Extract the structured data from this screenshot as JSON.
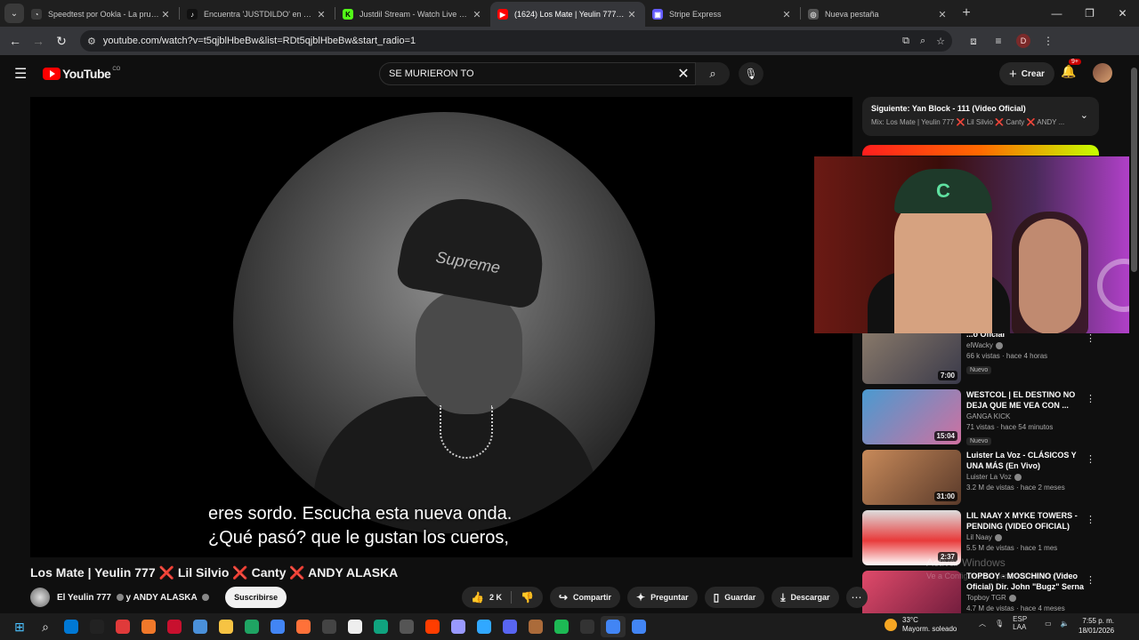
{
  "browser": {
    "tabs": [
      {
        "title": "Speedtest por Ookla - La prueba de",
        "icon": "speedtest-icon",
        "color": "#9aa0a6"
      },
      {
        "title": "Encuentra 'JUSTDILDO' en TikTok |",
        "icon": "tiktok-icon",
        "color": "#ffffff"
      },
      {
        "title": "Justdil Stream - Watch Live on Kick",
        "icon": "kick-icon",
        "color": "#53fc18"
      },
      {
        "title": "(1624) Los Mate | Yeulin 777 ❌ Lil",
        "icon": "youtube-icon",
        "color": "#ff0000"
      },
      {
        "title": "Stripe Express",
        "icon": "stripe-icon",
        "color": "#635bff"
      },
      {
        "title": "Nueva pestaña",
        "icon": "chrome-icon",
        "color": "#9aa0a6"
      }
    ],
    "url": "youtube.com/watch?v=t5qjblHbeBw&list=RDt5qjblHbeBw&start_radio=1",
    "profile_initial": "D"
  },
  "youtube": {
    "logo_text": "YouTube",
    "country": "CO",
    "search_value": "SE MURIERON TO",
    "create_label": "Crear",
    "notif_count": "9+"
  },
  "player": {
    "subtitle_line1": "eres sordo. Escucha esta nueva onda.",
    "subtitle_line2": "¿Qué pasó? que le gustan los cueros,",
    "beanie_text": "Supreme"
  },
  "pip": {
    "cap_letter": "C"
  },
  "video": {
    "title": "Los Mate | Yeulin 777 ❌ Lil Silvio ❌ Canty ❌ ANDY ALASKA",
    "channel": "El Yeulin 777",
    "collab": "y ANDY ALASKA",
    "subscribe": "Suscribirse",
    "likes": "2 K",
    "share": "Compartir",
    "ask": "Preguntar",
    "save": "Guardar",
    "download": "Descargar"
  },
  "next": {
    "title": "Siguiente: Yan Block - 111 (Video Oficial)",
    "mix": "Mix: Los Mate | Yeulin 777 ❌ Lil Silvio ❌ Canty ❌ ANDY ..."
  },
  "related": [
    {
      "title": "...o Oficial",
      "channel": "elWacky",
      "stats": "66 k vistas · hace 4 horas",
      "badge": "Nuevo",
      "duration": "7:00",
      "thumb": "#6b5a4a"
    },
    {
      "title": "WESTCOL | EL DESTINO NO DEJA QUE ME VEA CON ...",
      "channel": "GANGA KICK",
      "stats": "71 vistas · hace 54 minutos",
      "badge": "Nuevo",
      "duration": "15:04",
      "thumb": "#2a6a9a"
    },
    {
      "title": "Luister La Voz - CLÁSICOS Y UNA MÁS (En Vivo)",
      "channel": "Luister La Voz",
      "stats": "3.2 M de vistas · hace 2 meses",
      "badge": "",
      "duration": "31:00",
      "thumb": "#8a5a3a"
    },
    {
      "title": "LIL NAAY X MYKE TOWERS - PENDING (VIDEO OFICIAL)",
      "channel": "Lil Naay",
      "stats": "5.5 M de vistas · hace 1 mes",
      "badge": "",
      "duration": "2:37",
      "thumb": "#c83a3a"
    },
    {
      "title": "TOPBOY - MOSCHINO (Video Oficial) Dir. John \"Bugz\" Serna",
      "channel": "Topboy TGR",
      "stats": "4.7 M de vistas · hace 4 meses",
      "badge": "",
      "duration": "",
      "thumb": "#b0304a"
    }
  ],
  "overlay": {
    "activate": "Activar Windows",
    "activate_sub": "Ve a Configuración para activar Windows."
  },
  "taskbar": {
    "weather_temp": "33°C",
    "weather_desc": "Mayorm. soleado",
    "lang1": "ESP",
    "lang2": "LAA",
    "time": "7:55 p. m.",
    "date": "18/01/2026",
    "apps": [
      "#0078d4",
      "#222",
      "#e03a3a",
      "#f0782a",
      "#c8102e",
      "#4a90d9",
      "#f6c343",
      "#1fa463",
      "#4285f4",
      "#ff7139",
      "#444",
      "#eee",
      "#10a37f",
      "#555",
      "#ff3d00",
      "#9999ff",
      "#31a8ff",
      "#5865f2",
      "#ab6b3a",
      "#1db954",
      "#333",
      "#4285f4",
      "#4285f4"
    ]
  }
}
